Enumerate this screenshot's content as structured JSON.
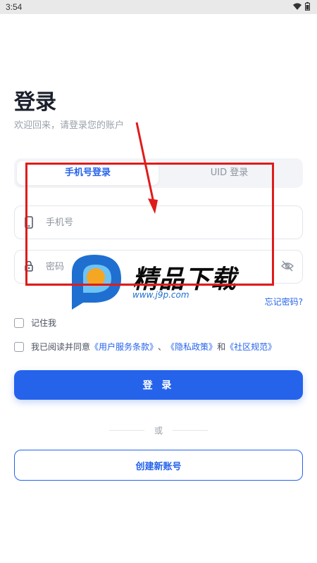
{
  "status_bar": {
    "time": "3:54",
    "wifi_icon": "wifi-icon",
    "battery_icon": "battery-icon"
  },
  "header": {
    "title": "登录",
    "subtitle": "欢迎回来，请登录您的账户"
  },
  "tabs": [
    {
      "label": "手机号登录",
      "active": true
    },
    {
      "label": "UID 登录",
      "active": false
    }
  ],
  "form": {
    "phone": {
      "placeholder": "手机号",
      "value": "",
      "icon": "phone-icon"
    },
    "password": {
      "placeholder": "密码",
      "value": "",
      "icon": "lock-icon",
      "toggle_icon": "eye-off-icon"
    },
    "forgot_label": "忘记密码?",
    "remember_label": "记住我",
    "agree": {
      "prefix": "我已阅读并同意",
      "terms": "《用户服务条款》",
      "sep": "、",
      "privacy": "《隐私政策》",
      "and": "和",
      "community": "《社区规范》"
    },
    "login_label": "登 录",
    "or_label": "或",
    "create_label": "创建新账号"
  },
  "watermark": {
    "text": "精品下载",
    "url": "www.j9p.com"
  },
  "colors": {
    "accent": "#2563eb",
    "annotation": "#e01b1b"
  }
}
